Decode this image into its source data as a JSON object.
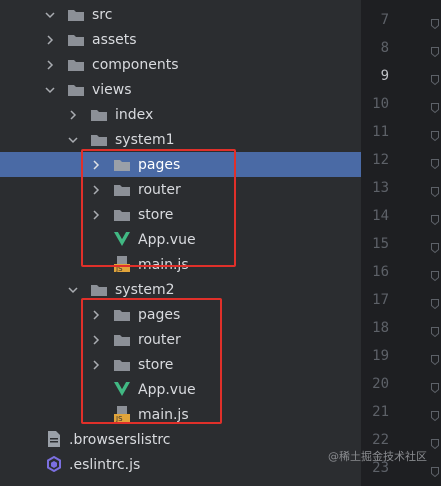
{
  "tree": {
    "items": [
      {
        "label": "src",
        "type": "folder",
        "expanded": true
      },
      {
        "label": "assets",
        "type": "folder",
        "expanded": false
      },
      {
        "label": "components",
        "type": "folder",
        "expanded": false
      },
      {
        "label": "views",
        "type": "folder",
        "expanded": true
      },
      {
        "label": "index",
        "type": "folder",
        "expanded": false
      },
      {
        "label": "system1",
        "type": "folder",
        "expanded": true
      },
      {
        "label": "pages",
        "type": "folder",
        "expanded": false,
        "selected": true
      },
      {
        "label": "router",
        "type": "folder",
        "expanded": false
      },
      {
        "label": "store",
        "type": "folder",
        "expanded": false
      },
      {
        "label": "App.vue",
        "type": "vue"
      },
      {
        "label": "main.js",
        "type": "js"
      },
      {
        "label": "system2",
        "type": "folder",
        "expanded": true
      },
      {
        "label": "pages",
        "type": "folder",
        "expanded": false
      },
      {
        "label": "router",
        "type": "folder",
        "expanded": false
      },
      {
        "label": "store",
        "type": "folder",
        "expanded": false
      },
      {
        "label": "App.vue",
        "type": "vue"
      },
      {
        "label": "main.js",
        "type": "js"
      },
      {
        "label": ".browserslistrc",
        "type": "config"
      },
      {
        "label": ".eslintrc.js",
        "type": "eslint"
      }
    ]
  },
  "gutter": {
    "lines": [
      "7",
      "8",
      "9",
      "10",
      "11",
      "12",
      "13",
      "14",
      "15",
      "16",
      "17",
      "18",
      "19",
      "20",
      "21",
      "22",
      "23"
    ],
    "active_line": "9"
  },
  "watermark": "@稀土掘金技术社区",
  "colors": {
    "selection": "#4a6aa5",
    "highlight_box": "#e0302a",
    "vue": "#41b883"
  }
}
